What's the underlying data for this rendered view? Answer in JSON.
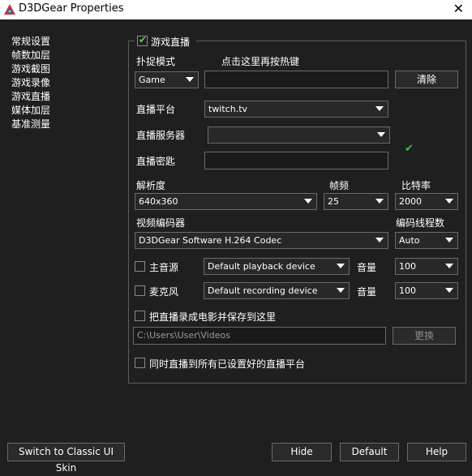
{
  "window": {
    "title": "D3DGear Properties",
    "close_glyph": "✕"
  },
  "nav": {
    "items": [
      "常规设置",
      "帧数加层",
      "游戏截图",
      "游戏录像",
      "游戏直播",
      "媒体加层",
      "基准测量"
    ]
  },
  "stream": {
    "enable_label": "游戏直播",
    "enabled": true,
    "capture_mode_label": "扑捉模式",
    "capture_mode_value": "Game",
    "hotkey_hint": "点击这里再按热键",
    "hotkey_value": "",
    "clear_label": "清除",
    "platform_label": "直播平台",
    "platform_value": "twitch.tv",
    "server_label": "直播服务器",
    "server_value": "",
    "key_label": "直播密匙",
    "key_value": "",
    "key_valid_glyph": "✔",
    "resolution_label": "解析度",
    "resolution_value": "640x360",
    "fps_label": "帧频",
    "fps_value": "25",
    "bitrate_label": "比特率",
    "bitrate_value": "2000",
    "encoder_label": "视频编码器",
    "encoder_value": "D3DGear Software H.264 Codec",
    "threads_label": "编码线程数",
    "threads_value": "Auto",
    "main_audio_label": "主音源",
    "main_audio_device": "Default playback device",
    "main_volume_label": "音量",
    "main_volume_value": "100",
    "mic_label": "麦克风",
    "mic_device": "Default recording device",
    "mic_volume_label": "音量",
    "mic_volume_value": "100",
    "save_movie_label": "把直播录成电影并保存到这里",
    "save_path": "C:\\Users\\User\\Videos",
    "change_label": "更换",
    "multi_stream_label": "同时直播到所有已设置好的直播平台"
  },
  "footer": {
    "classic_label": "Switch to Classic UI Skin",
    "hide_label": "Hide",
    "default_label": "Default",
    "help_label": "Help"
  },
  "colors": {
    "background": "#1f1f1f",
    "check_green": "#5bd35b",
    "border": "#6a6a6a"
  }
}
